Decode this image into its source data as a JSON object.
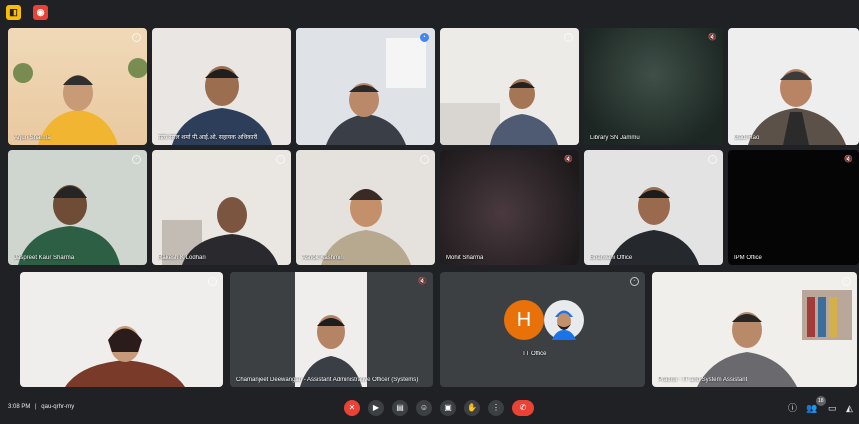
{
  "topbar": {
    "icon1": "lock-icon",
    "icon2": "record-icon",
    "icon1_glyph": "◧",
    "icon2_glyph": "◉"
  },
  "tiles": [
    {
      "name": "Arjun Sharma",
      "pinned": true
    },
    {
      "name": "सत्य सरल शर्मा पी.आई.ओ. सहायक अधिकारी",
      "pinned": false
    },
    {
      "name": "",
      "pinned": true,
      "active": true
    },
    {
      "name": "",
      "pinned": true
    },
    {
      "name": "Library SN Jammu",
      "pinned": false,
      "muted": true
    },
    {
      "name": "Gadi Rao",
      "pinned": false
    },
    {
      "name": "Jaspreet Kaur Sharma",
      "pinned": true
    },
    {
      "name": "Rakesh K Lodhari",
      "pinned": false
    },
    {
      "name": "Ashok Kashmiri",
      "pinned": true
    },
    {
      "name": "Mohit Sharma",
      "pinned": false,
      "muted": true
    },
    {
      "name": "Bharwani Office",
      "pinned": true
    },
    {
      "name": "IPM Office",
      "pinned": false,
      "muted": true
    },
    {
      "name": "",
      "pinned": true
    },
    {
      "name": "Chamanjeet Deewangan - Assistant Administrative Officer (Systems)",
      "pinned": false,
      "muted": true
    },
    {
      "name": "TT Office",
      "pinned": true,
      "avatars": [
        {
          "letter": "H",
          "color": "#e8710a"
        },
        {
          "letter": "",
          "color": "#4285f4"
        }
      ]
    },
    {
      "name": "Prathur - IT and System Assistant",
      "pinned": true
    }
  ],
  "bottombar": {
    "time": "3:08 PM",
    "separator": "|",
    "meeting_code": "qau-qrhr-rny",
    "controls": [
      "mic-off-icon",
      "camera-icon",
      "captions-icon",
      "emoji-icon",
      "present-icon",
      "raise-hand-icon",
      "more-icon"
    ],
    "control_glyphs": [
      "✕",
      "▶",
      "▤",
      "☺",
      "▣",
      "✋",
      "⋮"
    ],
    "hangup_glyph": "✆",
    "right": [
      "info-icon",
      "people-icon",
      "chat-icon",
      "activities-icon"
    ],
    "right_glyphs": [
      "ⓘ",
      "👥",
      "▭",
      "◭"
    ],
    "people_count": "18"
  }
}
